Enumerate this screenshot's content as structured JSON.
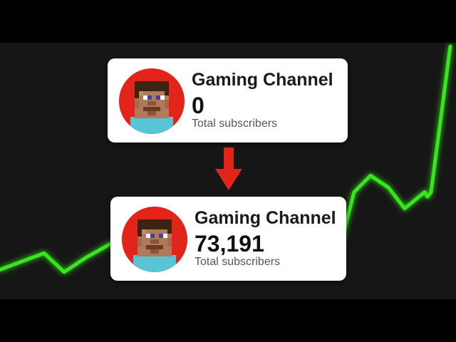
{
  "colors": {
    "background": "#000000",
    "panel": "#161616",
    "graph_line": "#39e61f",
    "arrow": "#e3241b",
    "avatar_bg": "#e3241b"
  },
  "icons": {
    "avatar": "minecraft-steve-face-icon",
    "arrow": "arrow-down-icon"
  },
  "cards": {
    "before": {
      "channel_name": "Gaming Channel",
      "subscriber_count": "0",
      "subscriber_label": "Total subscribers"
    },
    "after": {
      "channel_name": "Gaming Channel",
      "subscriber_count": "73,191",
      "subscriber_label": "Total subscribers"
    }
  },
  "growth_trend": {
    "shape": "flat low line with a sharp rise at the right end",
    "relative_levels": [
      0.05,
      0.09,
      0.12,
      0.04,
      0.1,
      0.16,
      0.18,
      0.38,
      0.45,
      0.4,
      0.31,
      0.38,
      0.36,
      0.38,
      1.0
    ]
  }
}
